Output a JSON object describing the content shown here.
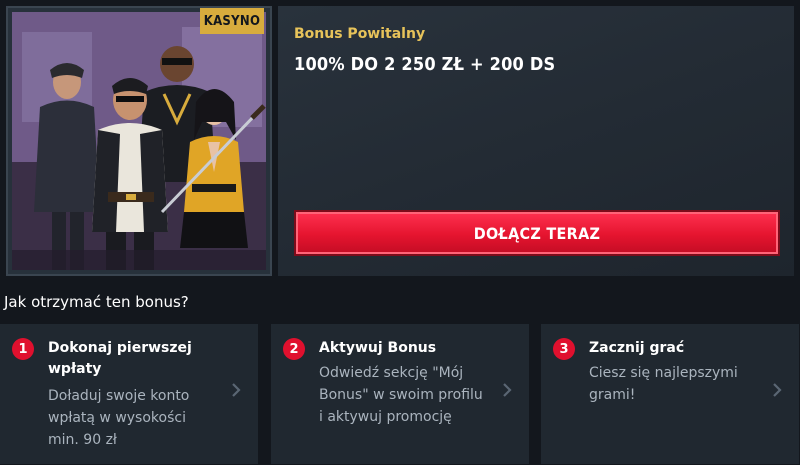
{
  "promo": {
    "tag": "KASYNO",
    "title": "Bonus Powitalny",
    "value": "100% DO 2 250 ZŁ + 200 DS",
    "cta": "DOŁĄCZ TERAZ",
    "colors": {
      "accent": "#e5142f",
      "gold": "#e7c35a",
      "tag_bg": "#d8ac3d"
    }
  },
  "how": {
    "heading": "Jak otrzymać ten bonus?",
    "steps": [
      {
        "number": "1",
        "title": "Dokonaj pierwszej wpłaty",
        "desc": "Doładuj swoje konto wpłatą w wysokości min. 90 zł"
      },
      {
        "number": "2",
        "title": "Aktywuj Bonus",
        "desc": "Odwiedź sekcję \"Mój Bonus\" w swoim profilu i aktywuj promocję"
      },
      {
        "number": "3",
        "title": "Zacznij grać",
        "desc": "Ciesz się najlepszymi grami!"
      }
    ]
  },
  "icons": {
    "chevron": "chevron-right-icon"
  }
}
